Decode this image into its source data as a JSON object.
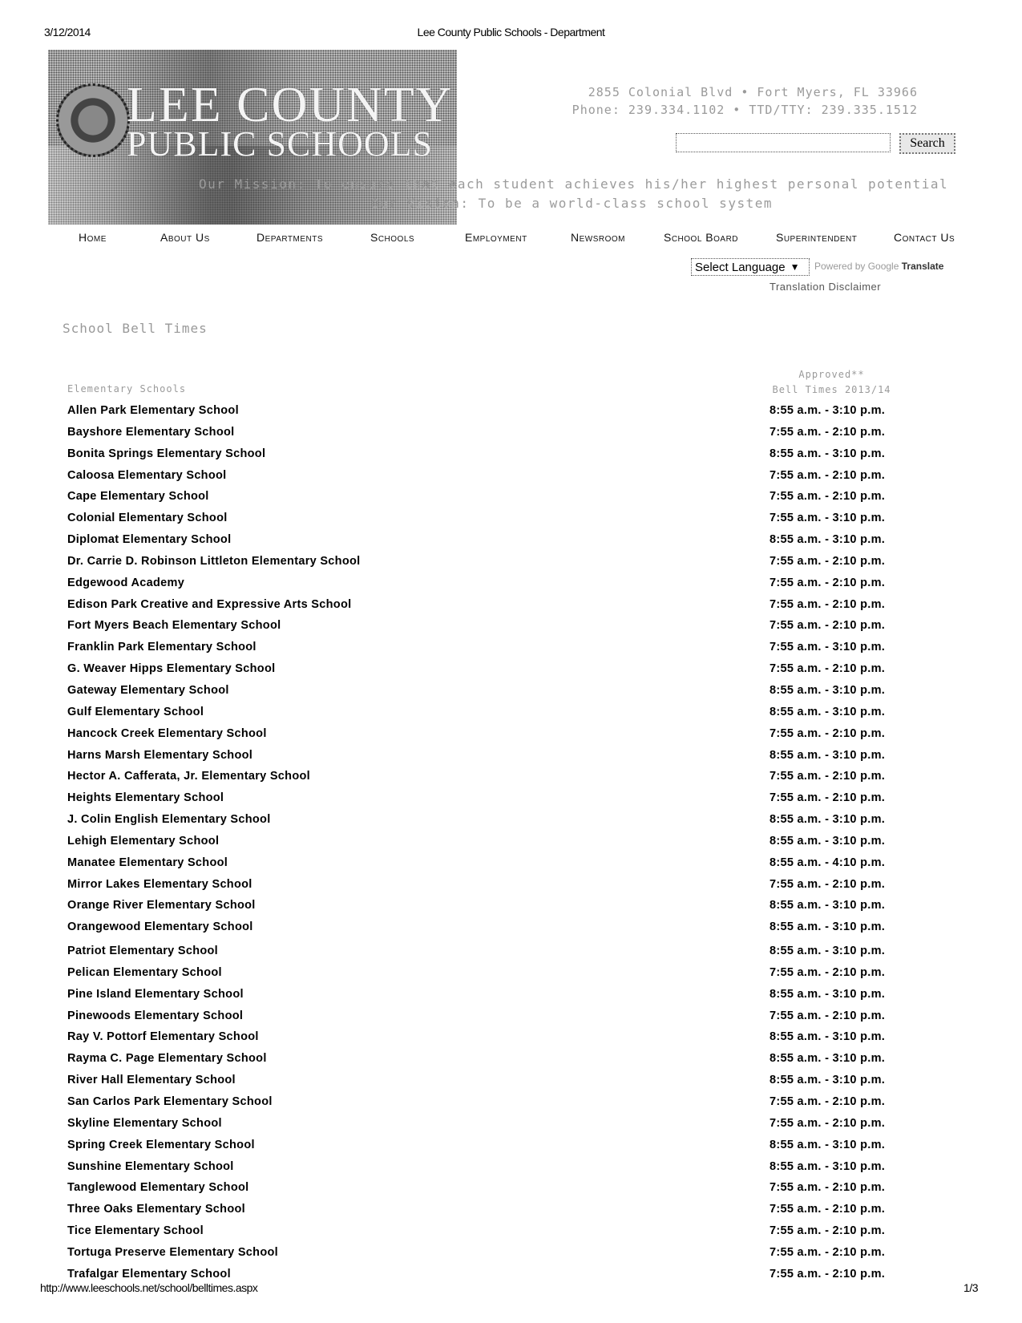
{
  "print_header": {
    "date": "3/12/2014",
    "title": "Lee County Public Schools - Department"
  },
  "banner": {
    "logo_line1": "LEE COUNTY",
    "logo_line2": "PUBLIC SCHOOLS",
    "mission": "Our Mission: To ensure that each student achieves his/her highest personal potential",
    "vision": "Our Vision: To be a world-class school system"
  },
  "contact": {
    "address": "2855 Colonial Blvd • Fort Myers, FL 33966",
    "phone": "Phone: 239.334.1102 • TTD/TTY: 239.335.1512"
  },
  "search": {
    "value": "",
    "placeholder": "",
    "button_label": "Search"
  },
  "nav": {
    "items": [
      {
        "label": "Home"
      },
      {
        "label": "About Us"
      },
      {
        "label": "Departments"
      },
      {
        "label": "Schools"
      },
      {
        "label": "Employment"
      },
      {
        "label": "Newsroom"
      },
      {
        "label": "School Board"
      },
      {
        "label": "Superintendent"
      },
      {
        "label": "Contact Us"
      }
    ]
  },
  "translate": {
    "select_label": "Select Language",
    "arrow_icon": "triangle-down",
    "powered_by": "Powered by Google",
    "translate_word": "Translate",
    "disclaimer": "Translation Disclaimer"
  },
  "main": {
    "heading": "School Bell Times",
    "column_left": "Elementary Schools",
    "column_right_line1": "Approved**",
    "column_right_line2": "Bell Times 2013/14",
    "rows": [
      {
        "name": "Allen Park Elementary School",
        "time": "8:55 a.m. - 3:10 p.m."
      },
      {
        "name": "Bayshore Elementary School",
        "time": "7:55 a.m. - 2:10 p.m."
      },
      {
        "name": "Bonita Springs Elementary School",
        "time": "8:55 a.m. - 3:10 p.m."
      },
      {
        "name": "Caloosa Elementary School",
        "time": "7:55 a.m. - 2:10 p.m."
      },
      {
        "name": "Cape Elementary School",
        "time": "7:55 a.m. - 2:10 p.m."
      },
      {
        "name": "Colonial Elementary School",
        "time": "7:55 a.m. - 3:10 p.m."
      },
      {
        "name": "Diplomat Elementary School",
        "time": "8:55 a.m. - 3:10 p.m."
      },
      {
        "name": "Dr. Carrie D. Robinson Littleton Elementary School",
        "time": "7:55 a.m. - 2:10 p.m."
      },
      {
        "name": "Edgewood Academy",
        "time": "7:55 a.m. - 2:10 p.m."
      },
      {
        "name": "Edison Park Creative and Expressive Arts School",
        "time": "7:55 a.m. - 2:10 p.m."
      },
      {
        "name": "Fort Myers Beach Elementary School",
        "time": "7:55 a.m. - 2:10 p.m."
      },
      {
        "name": "Franklin Park Elementary School",
        "time": "7:55 a.m. - 3:10 p.m."
      },
      {
        "name": "G. Weaver Hipps Elementary School",
        "time": "7:55 a.m. - 2:10 p.m."
      },
      {
        "name": "Gateway Elementary School",
        "time": "8:55 a.m. - 3:10 p.m."
      },
      {
        "name": "Gulf Elementary School",
        "time": "8:55 a.m. - 3:10 p.m."
      },
      {
        "name": "Hancock Creek Elementary School",
        "time": "7:55 a.m. - 2:10 p.m."
      },
      {
        "name": "Harns Marsh Elementary School",
        "time": "8:55 a.m. - 3:10 p.m."
      },
      {
        "name": "Hector A. Cafferata, Jr. Elementary School",
        "time": "7:55 a.m. - 2:10 p.m."
      },
      {
        "name": "Heights Elementary School",
        "time": "7:55 a.m. - 2:10 p.m."
      },
      {
        "name": "J. Colin English Elementary School",
        "time": "8:55 a.m. - 3:10 p.m."
      },
      {
        "name": "Lehigh Elementary School",
        "time": "8:55 a.m. - 3:10 p.m."
      },
      {
        "name": "Manatee Elementary School",
        "time": "8:55 a.m. - 4:10 p.m."
      },
      {
        "name": "Mirror Lakes Elementary School",
        "time": "7:55 a.m. - 2:10 p.m."
      },
      {
        "name": "Orange River Elementary School",
        "time": "8:55 a.m. - 3:10 p.m."
      },
      {
        "name": "Orangewood Elementary School",
        "time": "8:55 a.m. - 3:10 p.m."
      },
      {
        "name": "Patriot Elementary School",
        "time": "8:55 a.m. - 3:10 p.m."
      },
      {
        "name": "Pelican Elementary School",
        "time": "7:55 a.m. - 2:10 p.m."
      },
      {
        "name": "Pine Island Elementary School",
        "time": "8:55 a.m. - 3:10 p.m."
      },
      {
        "name": "Pinewoods Elementary School",
        "time": "7:55 a.m. - 2:10 p.m."
      },
      {
        "name": "Ray V. Pottorf Elementary School",
        "time": "8:55 a.m. - 3:10 p.m."
      },
      {
        "name": "Rayma C. Page Elementary School",
        "time": "8:55 a.m. - 3:10 p.m."
      },
      {
        "name": "River Hall Elementary School",
        "time": "8:55 a.m. - 3:10 p.m."
      },
      {
        "name": "San Carlos Park Elementary School",
        "time": "7:55 a.m. - 2:10 p.m."
      },
      {
        "name": "Skyline Elementary School",
        "time": "7:55 a.m. - 2:10 p.m."
      },
      {
        "name": "Spring Creek Elementary School",
        "time": "8:55 a.m. - 3:10 p.m."
      },
      {
        "name": "Sunshine Elementary School",
        "time": "8:55 a.m. - 3:10 p.m."
      },
      {
        "name": "Tanglewood Elementary School",
        "time": "7:55 a.m. - 2:10 p.m."
      },
      {
        "name": "Three Oaks Elementary School",
        "time": "7:55 a.m. - 2:10 p.m."
      },
      {
        "name": "Tice Elementary School",
        "time": "7:55 a.m. - 2:10 p.m."
      },
      {
        "name": "Tortuga Preserve Elementary School",
        "time": "7:55 a.m. - 2:10 p.m."
      },
      {
        "name": "Trafalgar Elementary School",
        "time": "7:55 a.m. - 2:10 p.m."
      }
    ]
  },
  "footer": {
    "url": "http://www.leeschools.net/school/belltimes.aspx",
    "page": "1/3"
  }
}
